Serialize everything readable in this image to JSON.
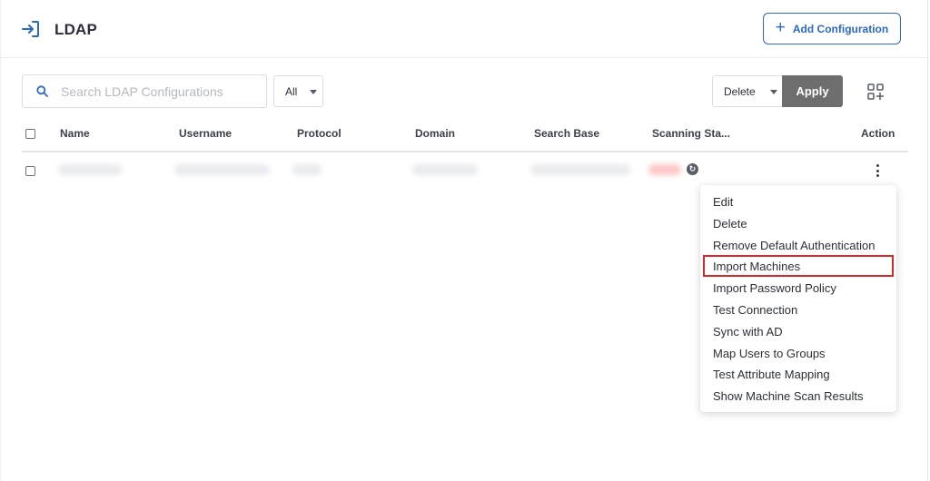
{
  "header": {
    "title": "LDAP",
    "add_button_label": "Add Configuration",
    "accent_color": "#2c68c7"
  },
  "toolbar": {
    "search_placeholder": "Search LDAP Configurations",
    "search_value": "",
    "filter_value": "All",
    "bulk_action_value": "Delete",
    "apply_label": "Apply"
  },
  "table": {
    "columns": [
      "Name",
      "Username",
      "Protocol",
      "Domain",
      "Search Base",
      "Scanning Sta...",
      "Action"
    ],
    "rows_visible": 1
  },
  "action_menu": {
    "items": [
      "Edit",
      "Delete",
      "Remove Default Authentication",
      "Import Machines",
      "Import Password Policy",
      "Test Connection",
      "Sync with AD",
      "Map Users to Groups",
      "Test Attribute Mapping",
      "Show Machine Scan Results"
    ],
    "highlighted_item": "Import Machines",
    "highlight_color": "#d8282b"
  },
  "icons": {
    "page": "login-arrow-icon",
    "search": "search-icon",
    "add": "plus-icon",
    "columns": "grid-add-icon",
    "status": "refresh-icon",
    "action": "kebab-menu-icon"
  }
}
